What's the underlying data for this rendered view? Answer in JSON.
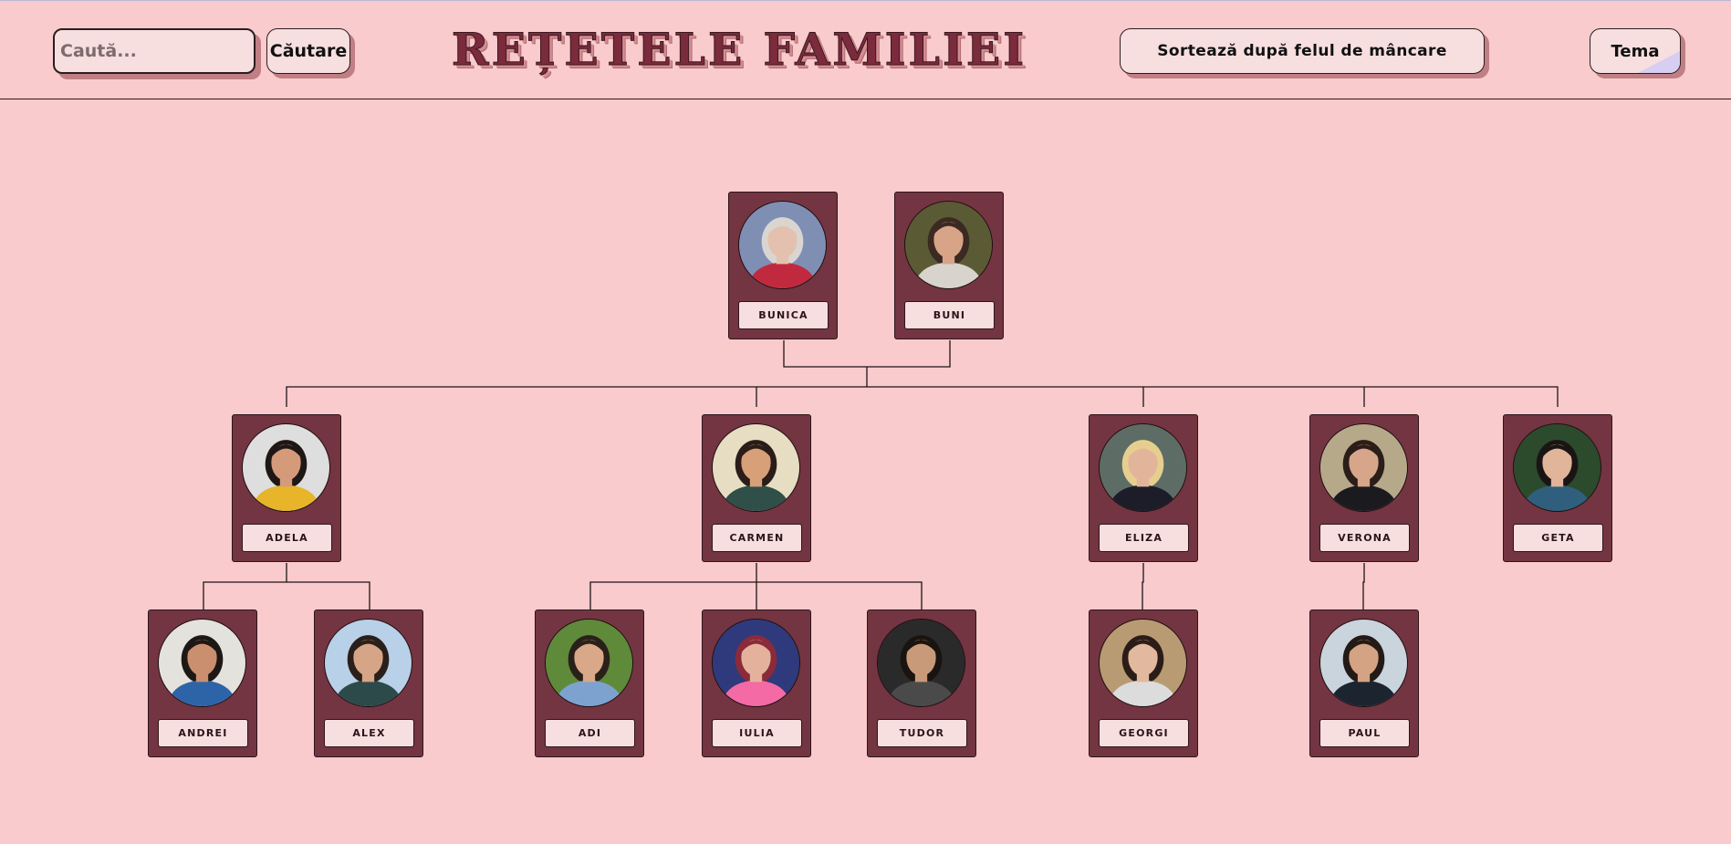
{
  "header": {
    "search_placeholder": "Caută...",
    "search_button": "Căutare",
    "title": "REȚETELE FAMILIEI",
    "sort_button": "Sortează după felul de mâncare",
    "theme_button": "Tema"
  },
  "family": {
    "generation_1": [
      {
        "name": "BUNICA",
        "bg": "#7f8fb4",
        "skin": "#e4c1ae",
        "hair": "#d9d6d2",
        "shirt": "#c12a3e"
      },
      {
        "name": "BUNI",
        "bg": "#5a5a34",
        "skin": "#d7a488",
        "hair": "#3a2a22",
        "shirt": "#d8d3cc"
      }
    ],
    "generation_2": [
      {
        "name": "ADELA",
        "bg": "#dedede",
        "skin": "#d49a7a",
        "hair": "#1e1716",
        "shirt": "#e7b42a"
      },
      {
        "name": "CARMEN",
        "bg": "#e6ddc2",
        "skin": "#d7a079",
        "hair": "#2a1c18",
        "shirt": "#2f4f48"
      },
      {
        "name": "ELIZA",
        "bg": "#5d6d66",
        "skin": "#e2b59b",
        "hair": "#e6cf8e",
        "shirt": "#1d1d2a"
      },
      {
        "name": "VERONA",
        "bg": "#b6a98a",
        "skin": "#d6a58a",
        "hair": "#2b1d18",
        "shirt": "#1b1b1f"
      },
      {
        "name": "GETA",
        "bg": "#2c4a2c",
        "skin": "#e0b59a",
        "hair": "#1a1514",
        "shirt": "#2f5f7c"
      }
    ],
    "generation_3": [
      {
        "name": "ANDREI",
        "bg": "#e4e2dc",
        "skin": "#c98f6f",
        "hair": "#1d1715",
        "shirt": "#2d64a8"
      },
      {
        "name": "ALEX",
        "bg": "#b8d0e8",
        "skin": "#d6a588",
        "hair": "#2a1f1a",
        "shirt": "#2c4a4a"
      },
      {
        "name": "ADI",
        "bg": "#5e8a3a",
        "skin": "#d8a888",
        "hair": "#2a201a",
        "shirt": "#7ea2cf"
      },
      {
        "name": "IULIA",
        "bg": "#2e3a7c",
        "skin": "#e4b29c",
        "hair": "#8b2a3a",
        "shirt": "#f36aa4"
      },
      {
        "name": "TUDOR",
        "bg": "#2a2a2a",
        "skin": "#c99a7a",
        "hair": "#1a1410",
        "shirt": "#4a4a4a"
      },
      {
        "name": "GEORGI",
        "bg": "#b89b72",
        "skin": "#e2b89e",
        "hair": "#2b1c18",
        "shirt": "#dcdcdc"
      },
      {
        "name": "PAUL",
        "bg": "#c9d4dc",
        "skin": "#d4a384",
        "hair": "#231a16",
        "shirt": "#1c2430"
      }
    ]
  }
}
